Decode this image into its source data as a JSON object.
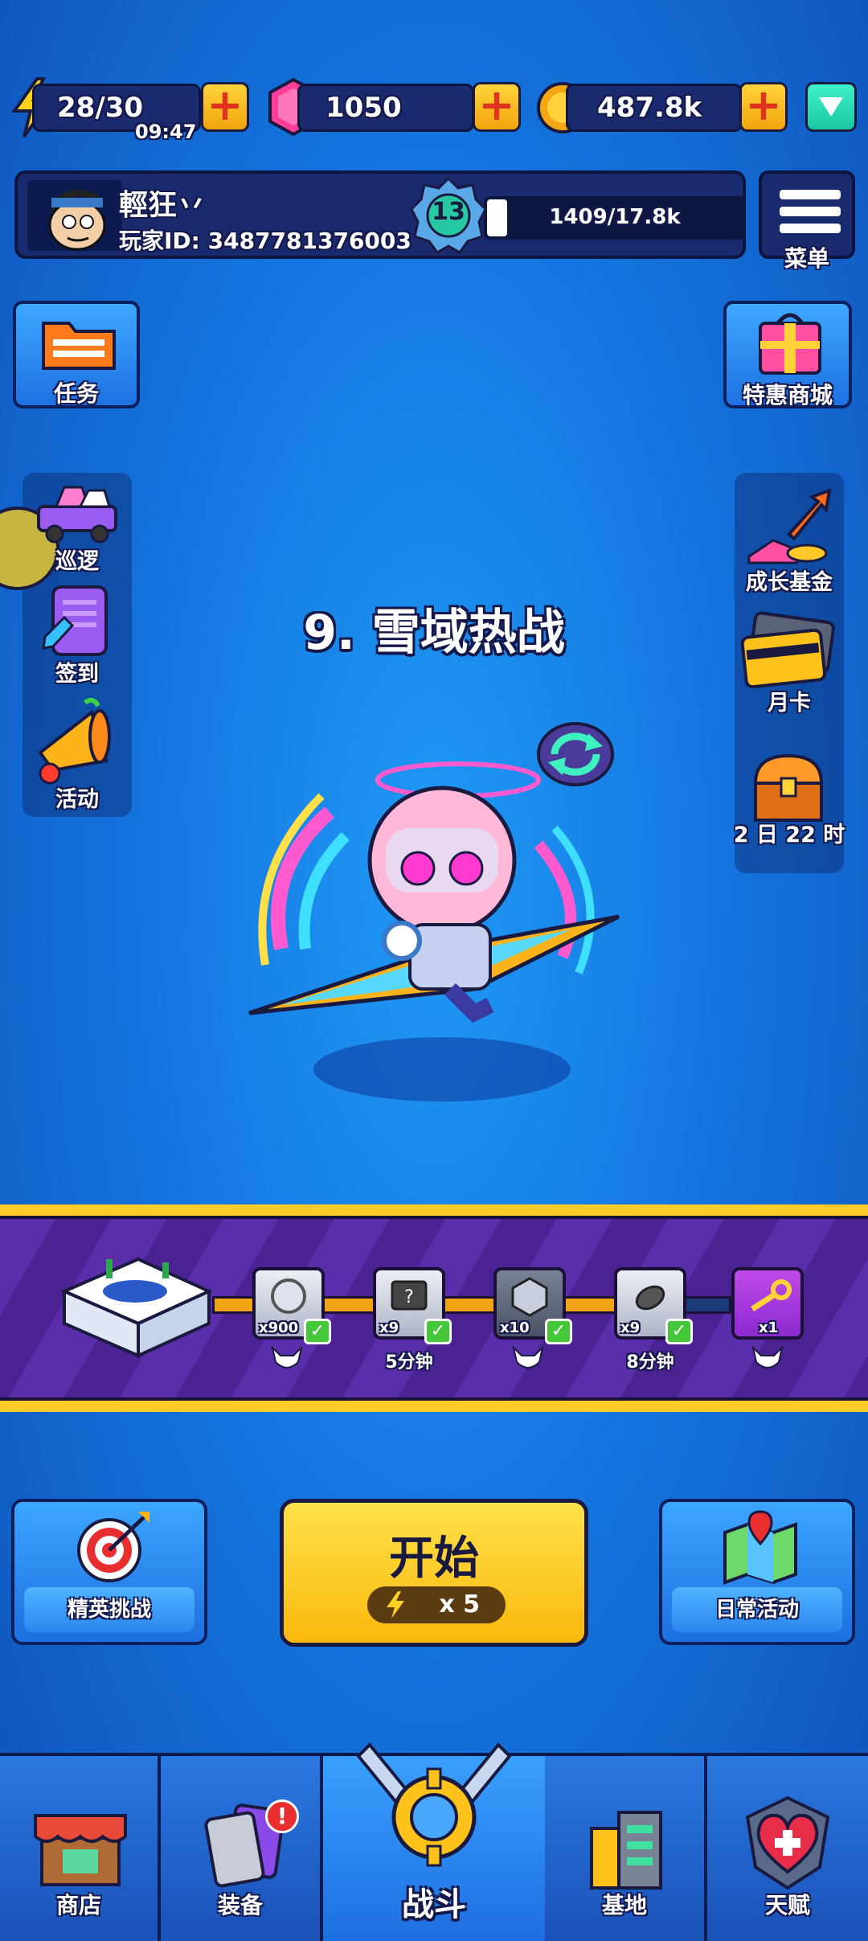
{
  "resources": {
    "energy": "28/30",
    "energy_timer": "09:47",
    "gems": "1050",
    "coins": "487.8k"
  },
  "profile": {
    "name": "輕狂丷",
    "player_id": "玩家ID: 3487781376003",
    "level": "13",
    "xp": "1409/17.8k",
    "xp_fraction": 0.079
  },
  "menu_label": "菜单",
  "left_top": {
    "tasks": "任务"
  },
  "right_top": {
    "shop_offer": "特惠商城"
  },
  "left_column": [
    "巡逻",
    "签到",
    "活动"
  ],
  "right_column": {
    "growth_fund": "成长基金",
    "monthly_card": "月卡",
    "timer": "2 日 22 时"
  },
  "stage_title": "9. 雪域热战",
  "rewards": [
    {
      "count": "x900",
      "label": "",
      "claimed": true
    },
    {
      "count": "x9",
      "label": "5分钟",
      "claimed": true
    },
    {
      "count": "x10",
      "label": "",
      "claimed": true
    },
    {
      "count": "x9",
      "label": "8分钟",
      "claimed": true
    },
    {
      "count": "x1",
      "label": "",
      "claimed": false
    }
  ],
  "actions": {
    "elite": "精英挑战",
    "start": "开始",
    "start_cost": "x 5",
    "daily": "日常活动"
  },
  "nav": {
    "shop": "商店",
    "equip": "装备",
    "battle": "战斗",
    "base": "基地",
    "talent": "天赋",
    "equip_badge": "!"
  },
  "colors": {
    "bg": "#1576e0",
    "gold": "#ffcd2a",
    "purple": "#5a2eaa",
    "gem": "#ff3e9a"
  }
}
